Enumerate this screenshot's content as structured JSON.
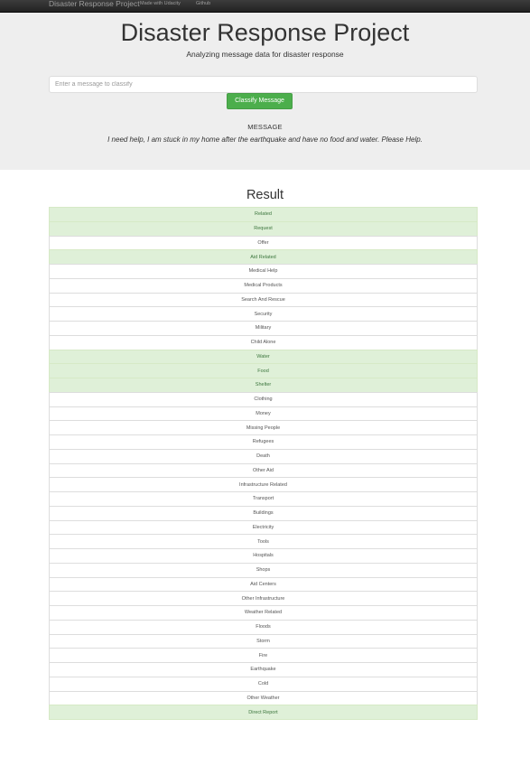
{
  "navbar": {
    "brand": "Disaster Response Project",
    "links": [
      "Made with Udacity",
      "Github"
    ]
  },
  "header": {
    "title": "Disaster Response Project",
    "subtitle": "Analyzing message data for disaster response"
  },
  "form": {
    "placeholder": "Enter a message to classify",
    "value": "",
    "button_label": "Classify Message"
  },
  "message": {
    "label": "MESSAGE",
    "text": "I need help, I am stuck in my home after the earthquake and have no food and water. Please Help."
  },
  "result": {
    "title": "Result",
    "categories": [
      {
        "label": "Related",
        "positive": true
      },
      {
        "label": "Request",
        "positive": true
      },
      {
        "label": "Offer",
        "positive": false
      },
      {
        "label": "Aid Related",
        "positive": true
      },
      {
        "label": "Medical Help",
        "positive": false
      },
      {
        "label": "Medical Products",
        "positive": false
      },
      {
        "label": "Search And Rescue",
        "positive": false
      },
      {
        "label": "Security",
        "positive": false
      },
      {
        "label": "Military",
        "positive": false
      },
      {
        "label": "Child Alone",
        "positive": false
      },
      {
        "label": "Water",
        "positive": true
      },
      {
        "label": "Food",
        "positive": true
      },
      {
        "label": "Shelter",
        "positive": true
      },
      {
        "label": "Clothing",
        "positive": false
      },
      {
        "label": "Money",
        "positive": false
      },
      {
        "label": "Missing People",
        "positive": false
      },
      {
        "label": "Refugees",
        "positive": false
      },
      {
        "label": "Death",
        "positive": false
      },
      {
        "label": "Other Aid",
        "positive": false
      },
      {
        "label": "Infrastructure Related",
        "positive": false
      },
      {
        "label": "Transport",
        "positive": false
      },
      {
        "label": "Buildings",
        "positive": false
      },
      {
        "label": "Electricity",
        "positive": false
      },
      {
        "label": "Tools",
        "positive": false
      },
      {
        "label": "Hospitals",
        "positive": false
      },
      {
        "label": "Shops",
        "positive": false
      },
      {
        "label": "Aid Centers",
        "positive": false
      },
      {
        "label": "Other Infrastructure",
        "positive": false
      },
      {
        "label": "Weather Related",
        "positive": false
      },
      {
        "label": "Floods",
        "positive": false
      },
      {
        "label": "Storm",
        "positive": false
      },
      {
        "label": "Fire",
        "positive": false
      },
      {
        "label": "Earthquake",
        "positive": false
      },
      {
        "label": "Cold",
        "positive": false
      },
      {
        "label": "Other Weather",
        "positive": false
      },
      {
        "label": "Direct Report",
        "positive": true
      }
    ]
  },
  "colors": {
    "navbar": "#222222",
    "jumbotron": "#eeeeee",
    "button": "#4cae4c",
    "positive_row": "#dff0d8",
    "positive_text": "#3c763d"
  }
}
